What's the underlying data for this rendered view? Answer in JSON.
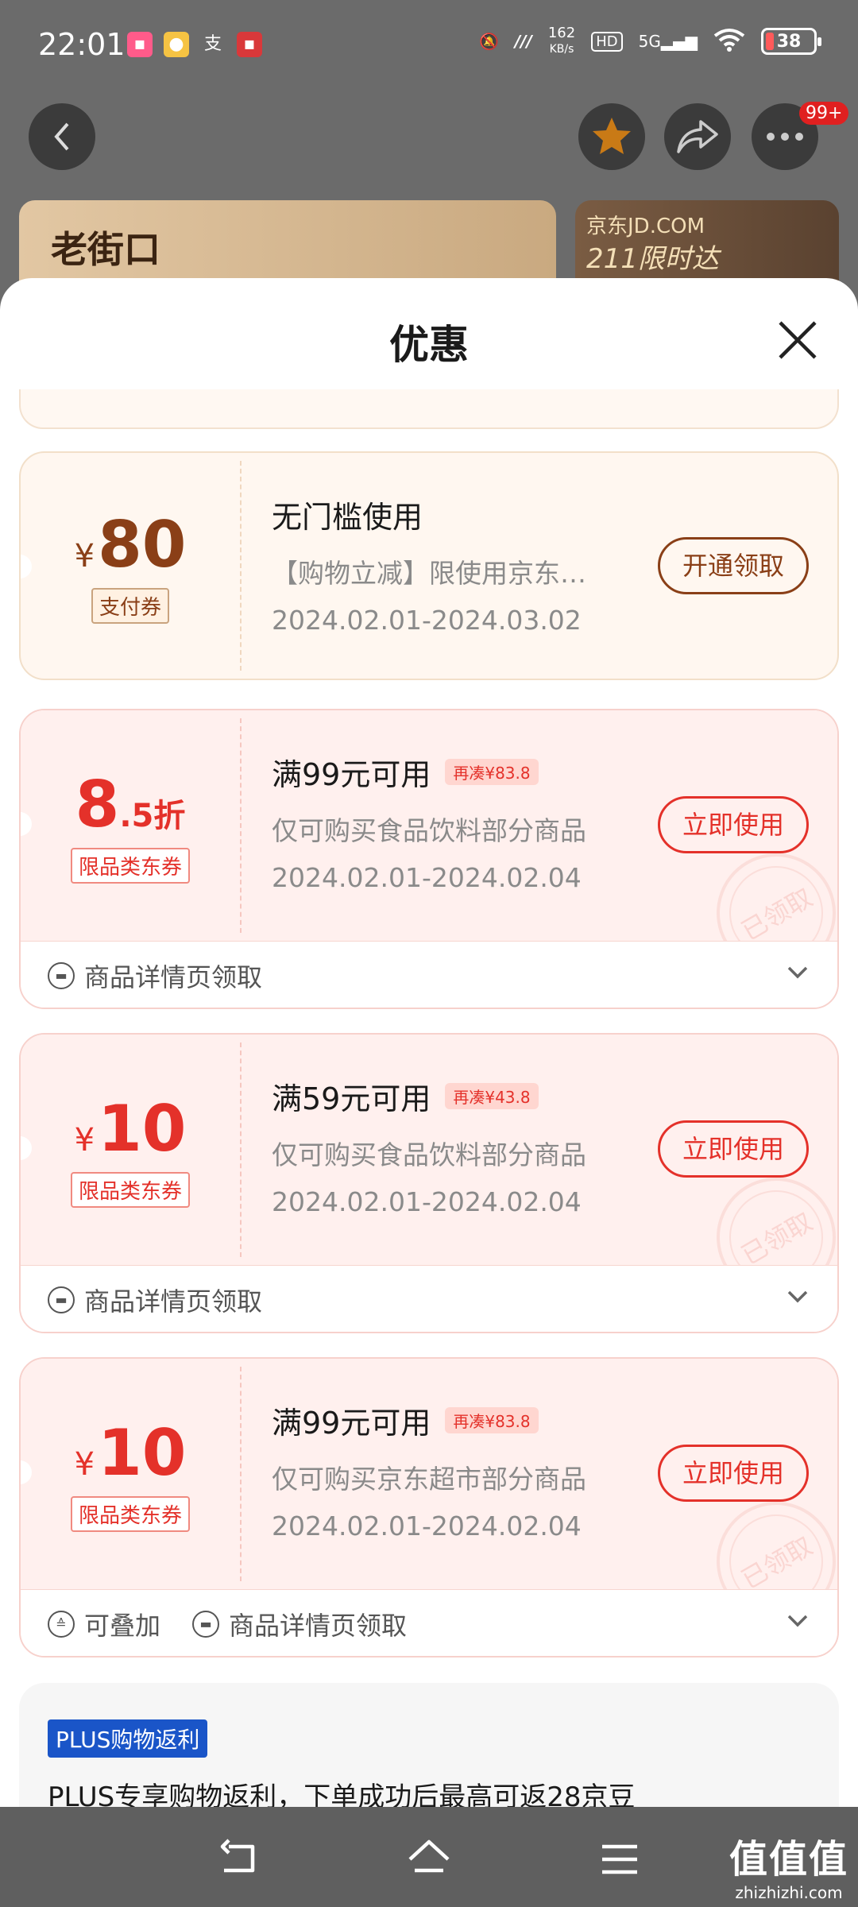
{
  "status_bar": {
    "time": "22:01",
    "net_speed_value": "162",
    "net_speed_unit": "KB/s",
    "hd": "HD",
    "network": "5G",
    "battery": "38"
  },
  "nav": {
    "badge": "99+"
  },
  "banners": {
    "left_logo": "老街口",
    "right_line1": "京东JD.COM",
    "right_line2": "211限时达"
  },
  "sheet": {
    "title": "优惠"
  },
  "coupons": [
    {
      "currency": "¥",
      "amount": "80",
      "tag": "支付券",
      "condition": "无门槛使用",
      "more": "",
      "description": "【购物立减】限使用京东…",
      "dates": "2024.02.01-2024.03.02",
      "button": "开通领取"
    },
    {
      "amount_main": "8",
      "amount_suffix": ".5折",
      "tag": "限品类东券",
      "condition": "满99元可用",
      "more": "再凑¥83.8",
      "description": "仅可购买食品饮料部分商品",
      "dates": "2024.02.01-2024.02.04",
      "button": "立即使用",
      "stamp": "已领取",
      "footer": "商品详情页领取"
    },
    {
      "currency": "¥",
      "amount": "10",
      "tag": "限品类东券",
      "condition": "满59元可用",
      "more": "再凑¥43.8",
      "description": "仅可购买食品饮料部分商品",
      "dates": "2024.02.01-2024.02.04",
      "button": "立即使用",
      "stamp": "已领取",
      "footer": "商品详情页领取"
    },
    {
      "currency": "¥",
      "amount": "10",
      "tag": "限品类东券",
      "condition": "满99元可用",
      "more": "再凑¥83.8",
      "description": "仅可购买京东超市部分商品",
      "dates": "2024.02.01-2024.02.04",
      "button": "立即使用",
      "stamp": "已领取",
      "footer_stack": "可叠加",
      "footer": "商品详情页领取"
    }
  ],
  "plus": {
    "label": "PLUS购物返利",
    "text": "PLUS专享购物返利，下单成功后最高可返28京豆"
  },
  "watermark": {
    "line1": "值值值",
    "line2": "zhizhizhi.com"
  }
}
